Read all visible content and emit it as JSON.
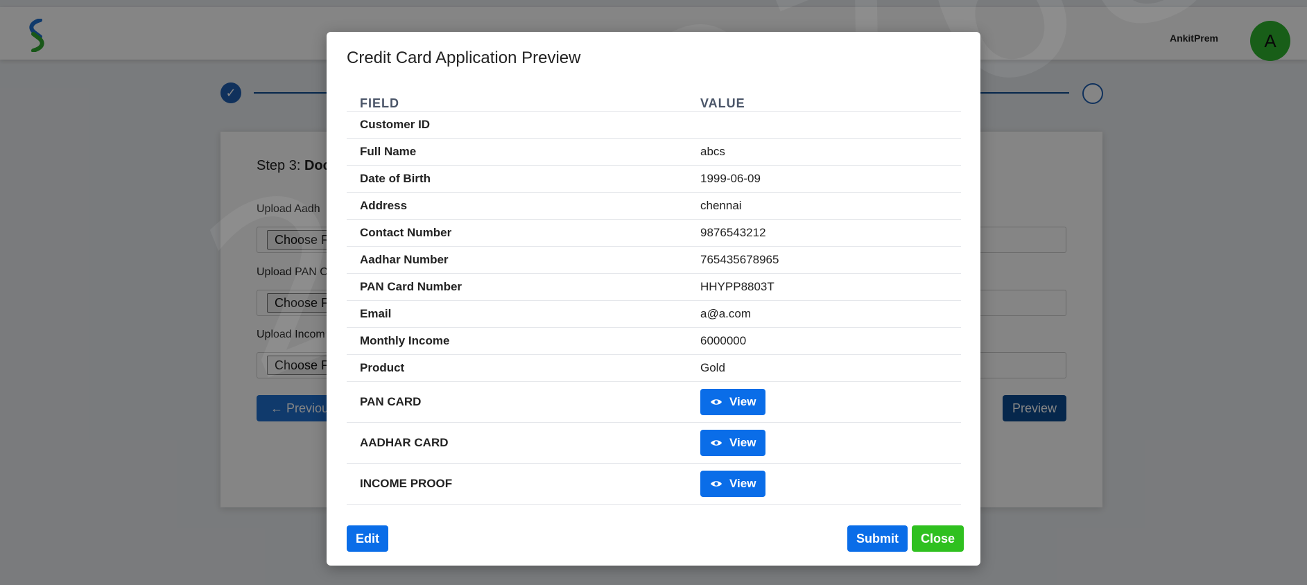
{
  "header": {
    "username": "AnkitPrem",
    "avatar_initial": "A",
    "logo_icon": "bank-logo-icon"
  },
  "form": {
    "step_prefix": "Step 3:",
    "step_name": "Doc",
    "fields": [
      {
        "label": "Upload Aadh",
        "button": "Choose Fi"
      },
      {
        "label": "Upload PAN C",
        "button": "Choose Fi"
      },
      {
        "label": "Upload Incom",
        "button": "Choose Fi"
      }
    ],
    "previous_label": "Previou",
    "preview_label": "Preview"
  },
  "watermark_text": "2019768",
  "modal": {
    "title": "Credit Card Application Preview",
    "headers": {
      "field": "FIELD",
      "value": "VALUE"
    },
    "rows": [
      {
        "field": "Customer ID",
        "value": ""
      },
      {
        "field": "Full Name",
        "value": "abcs"
      },
      {
        "field": "Date of Birth",
        "value": "1999-06-09"
      },
      {
        "field": "Address",
        "value": "chennai"
      },
      {
        "field": "Contact Number",
        "value": "9876543212"
      },
      {
        "field": "Aadhar Number",
        "value": "765435678965"
      },
      {
        "field": "PAN Card Number",
        "value": "HHYPP8803T"
      },
      {
        "field": "Email",
        "value": "a@a.com"
      },
      {
        "field": "Monthly Income",
        "value": "6000000"
      },
      {
        "field": "Product",
        "value": "Gold"
      }
    ],
    "documents": [
      {
        "field": "PAN CARD",
        "button": "View"
      },
      {
        "field": "AADHAR CARD",
        "button": "View"
      },
      {
        "field": "INCOME PROOF",
        "button": "View"
      }
    ],
    "edit_label": "Edit",
    "submit_label": "Submit",
    "close_label": "Close"
  },
  "colors": {
    "primary_button": "#0a6de8",
    "close_button": "#2fc01f",
    "avatar": "#2fb52f",
    "stepper": "#0d4c92"
  }
}
